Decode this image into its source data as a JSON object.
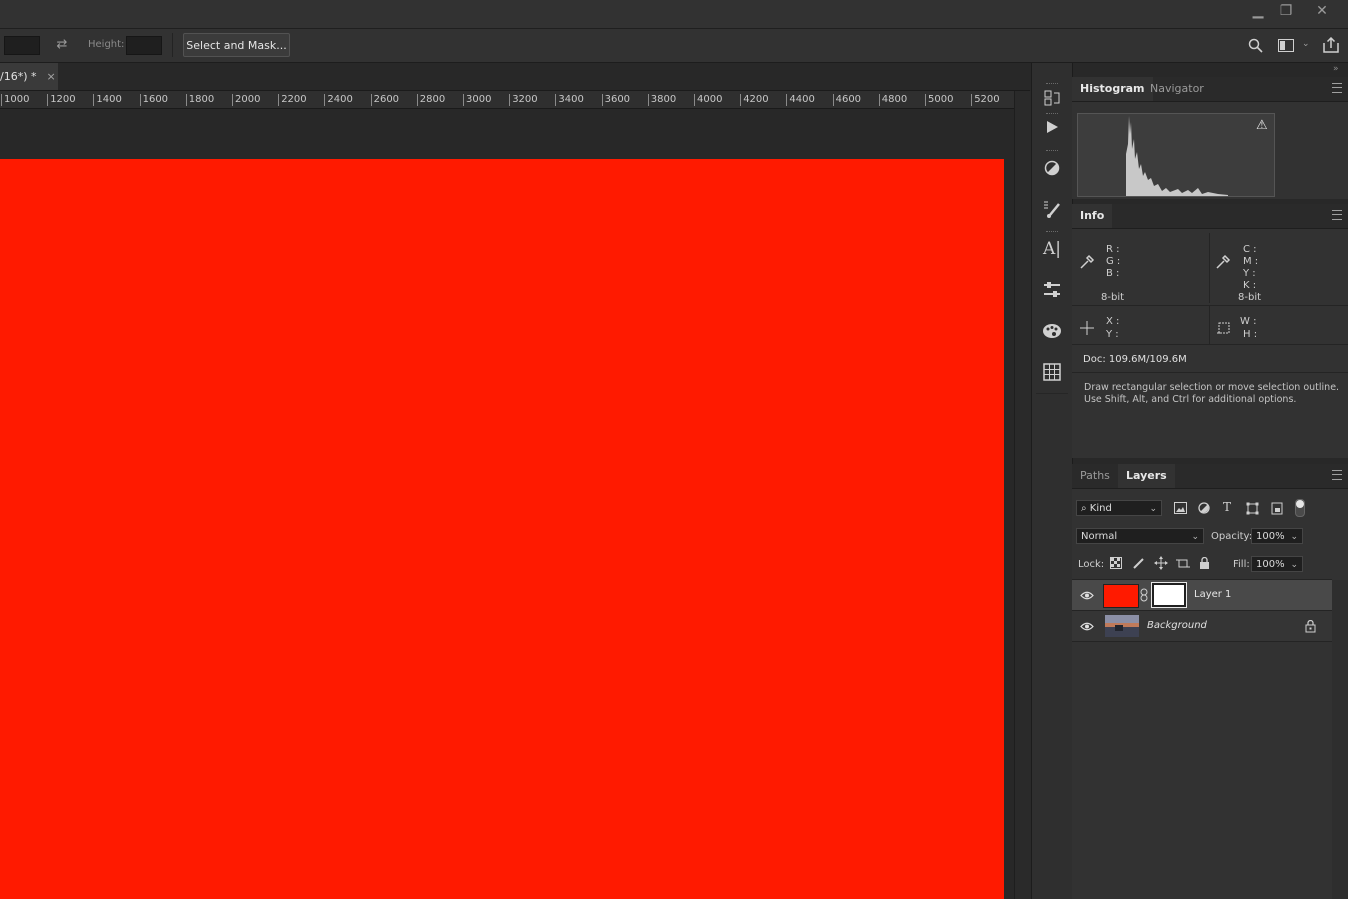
{
  "window": {
    "minimize_glyph": "▁",
    "restore_glyph": "❐",
    "close_glyph": "✕"
  },
  "options": {
    "height_label": "Height:",
    "select_mask_label": "Select and Mask..."
  },
  "document": {
    "tab_title": "/16*) *",
    "tab_close": "×",
    "canvas_color": "#ff1a00"
  },
  "ruler": {
    "ticks": [
      "1000",
      "1200",
      "1400",
      "1600",
      "1800",
      "2000",
      "2200",
      "2400",
      "2600",
      "2800",
      "3000",
      "3200",
      "3400",
      "3600",
      "3800",
      "4000",
      "4200",
      "4400",
      "4600",
      "4800",
      "5000",
      "5200"
    ]
  },
  "histogram_panel": {
    "tab_histogram": "Histogram",
    "tab_navigator": "Navigator",
    "warning_glyph": "⚠"
  },
  "info_panel": {
    "title": "Info",
    "r": "R :",
    "g": "G :",
    "b": "B :",
    "c": "C :",
    "m": "M :",
    "y": "Y :",
    "k": "K :",
    "bit_left": "8-bit",
    "bit_right": "8-bit",
    "x": "X :",
    "y2": "Y :",
    "w": "W :",
    "h": "H :",
    "doc": "Doc: 109.6M/109.6M",
    "hint_line1": "Draw rectangular selection or move selection outline.",
    "hint_line2": "Use Shift, Alt, and Ctrl for additional options."
  },
  "layers_panel": {
    "tab_paths": "Paths",
    "tab_layers": "Layers",
    "kind_label": "Kind",
    "blend_mode": "Normal",
    "opacity_label": "Opacity:",
    "opacity_value": "100%",
    "lock_label": "Lock:",
    "fill_label": "Fill:",
    "fill_value": "100%",
    "layers": [
      {
        "name": "Layer 1"
      },
      {
        "name": "Background"
      }
    ]
  },
  "colors": {
    "accent_red": "#ff1a00",
    "panel_bg": "#323232",
    "app_bg": "#282828"
  }
}
